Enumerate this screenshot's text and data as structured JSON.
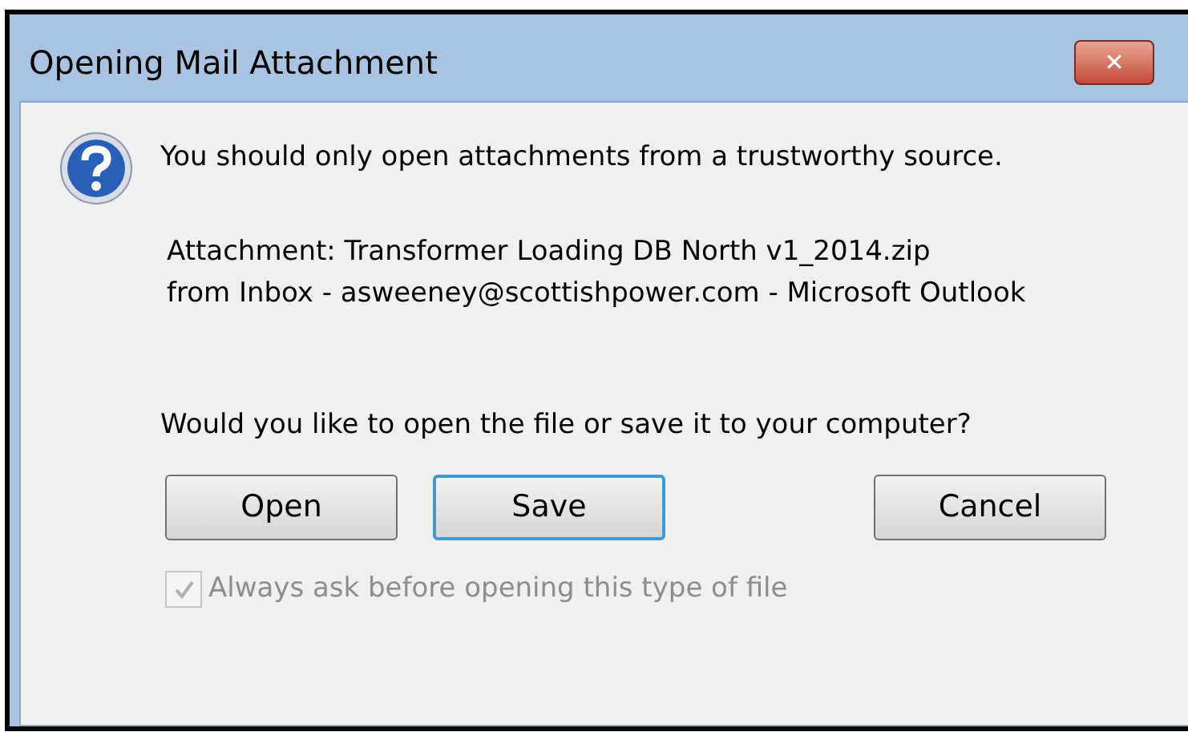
{
  "window": {
    "title": "Opening Mail Attachment",
    "close": "✕"
  },
  "message": "You should only open attachments from a trustworthy source.",
  "details": [
    "Attachment: Transformer Loading DB North v1_2014.zip",
    "from Inbox - asweeney@scottishpower.com - Microsoft Outlook"
  ],
  "question": "Would you like to open the file or save it to your computer?",
  "buttons": [
    {
      "label": "Open",
      "default": false
    },
    {
      "label": "Save",
      "default": true
    },
    {
      "label": "Cancel",
      "default": false
    }
  ],
  "checkbox": {
    "label": "Always ask before opening this type of file",
    "checked": true,
    "disabled": true
  }
}
